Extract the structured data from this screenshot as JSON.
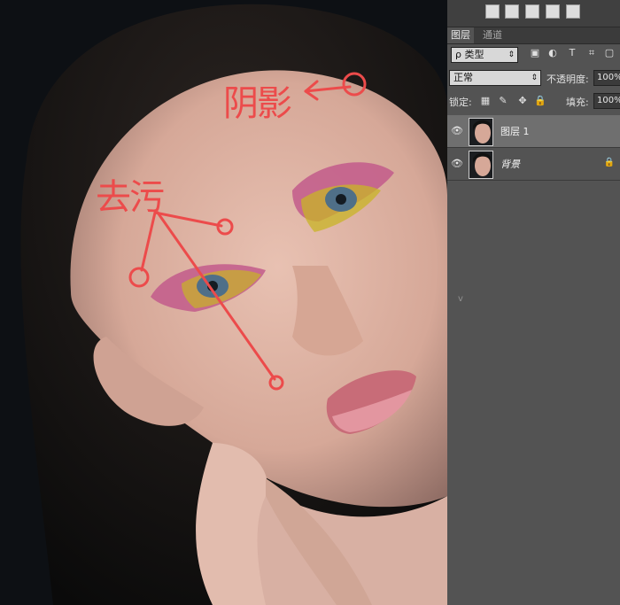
{
  "canvas": {
    "annotations": [
      {
        "text": "阴影"
      },
      {
        "text": "去污"
      }
    ]
  },
  "panel": {
    "top_tools": [
      "swap-icon",
      "gradient-icon",
      "lens-icon",
      "crop-icon",
      "rect-icon"
    ],
    "tabs": [
      {
        "label": "图层"
      },
      {
        "label": "通道"
      }
    ],
    "filter": {
      "kind_select": "ρ 类型",
      "icons": [
        "image-icon",
        "circle-icon",
        "T",
        "transform-icon",
        "fx-icon"
      ]
    },
    "blend": {
      "mode": "正常",
      "opacity_label": "不透明度:",
      "opacity_value": "100%"
    },
    "lock": {
      "label": "锁定:",
      "fill_label": "填充:",
      "fill_value": "100%"
    },
    "layers": [
      {
        "name": "图层 1",
        "selected": true
      },
      {
        "name": "背景",
        "selected": false,
        "locked": true
      }
    ],
    "cursor_mark": "v"
  }
}
